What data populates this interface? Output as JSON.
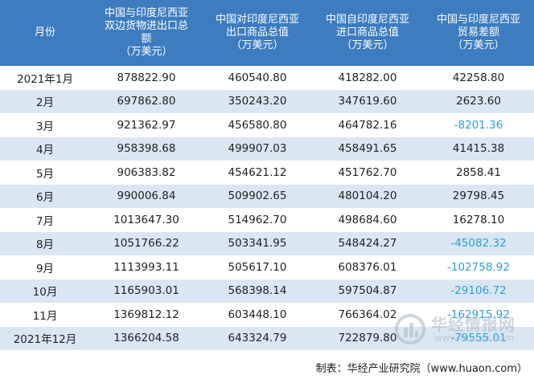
{
  "table": {
    "headers": [
      "月份",
      "中国与印度尼西亚双边货物进出口总额（万美元）",
      "中国对印度尼西亚出口商品总值（万美元）",
      "中国自印度尼西亚进口商品总值（万美元）",
      "中国与印度尼西亚贸易差额（万美元）"
    ],
    "header_lines": [
      [
        "月份"
      ],
      [
        "中国与印度尼西亚",
        "双边货物进出口总",
        "额",
        "（万美元）"
      ],
      [
        "中国对印度尼西亚",
        "出口商品总值",
        "（万美元）"
      ],
      [
        "中国自印度尼西亚",
        "进口商品总值",
        "（万美元）"
      ],
      [
        "中国与印度尼西亚",
        "贸易差额",
        "（万美元）"
      ]
    ],
    "rows": [
      [
        "2021年1月",
        "878822.90",
        "460540.80",
        "418282.00",
        "42258.80"
      ],
      [
        "2月",
        "697862.80",
        "350243.20",
        "347619.60",
        "2623.60"
      ],
      [
        "3月",
        "921362.97",
        "456580.80",
        "464782.16",
        "-8201.36"
      ],
      [
        "4月",
        "958398.68",
        "499907.03",
        "458491.65",
        "41415.38"
      ],
      [
        "5月",
        "906383.82",
        "454621.12",
        "451762.70",
        "2858.41"
      ],
      [
        "6月",
        "990006.84",
        "509902.65",
        "480104.20",
        "29798.45"
      ],
      [
        "7月",
        "1013647.30",
        "514962.70",
        "498684.60",
        "16278.10"
      ],
      [
        "8月",
        "1051766.22",
        "503341.95",
        "548424.27",
        "-45082.32"
      ],
      [
        "9月",
        "1113993.11",
        "505617.10",
        "608376.01",
        "-102758.92"
      ],
      [
        "10月",
        "1165903.01",
        "568398.14",
        "597504.87",
        "-29106.72"
      ],
      [
        "11月",
        "1369812.12",
        "603448.10",
        "766364.02",
        "-162915.92"
      ],
      [
        "2021年12月",
        "1366204.58",
        "643324.79",
        "722879.80",
        "-79555.01"
      ]
    ]
  },
  "footer": {
    "source": "制表：华经产业研究院（www.huaon.com）"
  },
  "watermark": {
    "name": "华经情报网",
    "url": "www.huaon.com",
    "icon": "huajing-logo-icon"
  },
  "colors": {
    "header_bg": "#3d7cbf",
    "stripe": "#dbe6f3",
    "negative": "#2a9fd4"
  }
}
